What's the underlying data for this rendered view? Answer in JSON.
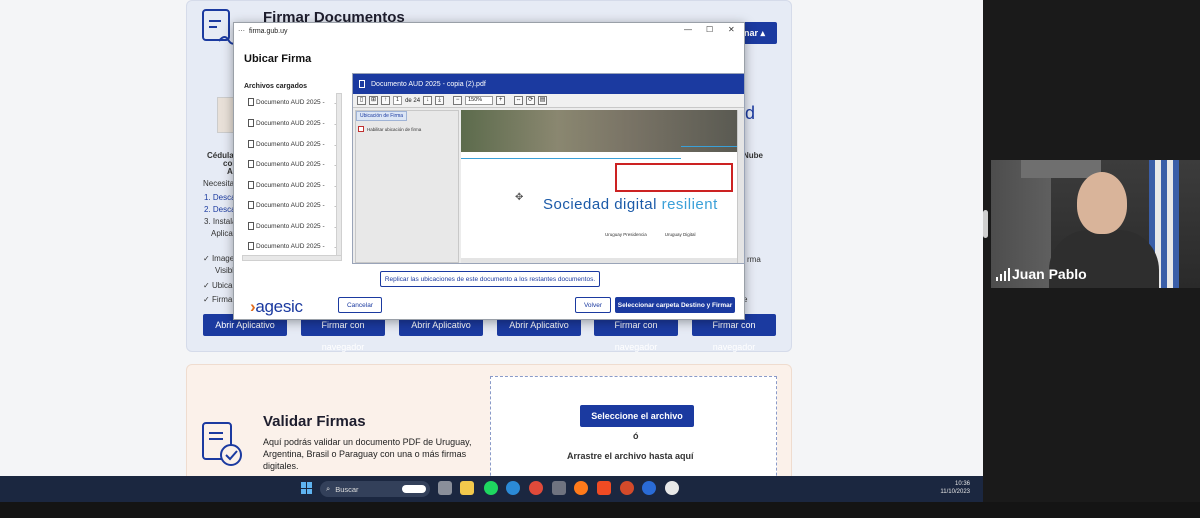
{
  "website": {
    "firmar_heading": "Firmar Documentos",
    "firmar_button": "… nar ▴",
    "cedula_col": [
      "Cédula",
      "con",
      "Ap"
    ],
    "necesitar": "Necesitar",
    "steps": [
      "1. Descar",
      "2. Descar",
      "3. Instalar",
      "Aplicat"
    ],
    "checks": [
      "Image",
      "Visible",
      "Ubica",
      "Firma"
    ],
    "id_fragment": "id",
    "nube_fragment": "Nube",
    "right_frag": "rma",
    "right_frag2": "e",
    "action_buttons": [
      "Abrir Aplicativo",
      "Firmar con navegador",
      "Abrir Aplicativo",
      "Abrir Aplicativo",
      "Firmar con navegador",
      "Firmar con navegador"
    ],
    "validar_heading": "Validar Firmas",
    "validar_text": [
      "Aquí podrás validar un documento PDF de Uruguay,",
      "Argentina, Brasil o Paraguay con una o más firmas",
      "digitales."
    ],
    "select_file_button": "Seleccione el archivo",
    "or_text": "ó",
    "drag_text": "Arrastre el archivo hasta aquí"
  },
  "dialog": {
    "url": "firma.gub.uy",
    "title": "Ubicar Firma",
    "files_label": "Archivos cargados",
    "files": [
      "Documento AUD 2025 -",
      "Documento AUD 2025 -",
      "Documento AUD 2025 -",
      "Documento AUD 2025 -",
      "Documento AUD 2025 -",
      "Documento AUD 2025 -",
      "Documento AUD 2025 -",
      "Documento AUD 2025 -"
    ],
    "viewer_title": "Documento AUD 2025 - copia (2).pdf",
    "page_current": "1",
    "page_total": "de 24",
    "zoom": "150%",
    "side_tab": "Ubicación de Firma",
    "side_check_label": "Habilitar ubicación de firma",
    "page_text_main": "Sociedad digital ",
    "page_text_accent": "resilient",
    "page_logos": [
      "Uruguay Presidencia",
      "Uruguay Digital"
    ],
    "replicate_button": "Replicar las ubicaciones de este documento a los restantes documentos.",
    "cancel_button": "Cancelar",
    "back_button": "Volver",
    "select_dest_button": "Seleccionar carpeta Destino y Firmar",
    "logo_text": "agesic"
  },
  "webcam": {
    "participant_name": "Juan Pablo"
  },
  "taskbar": {
    "search_placeholder": "Buscar",
    "time": "10:36",
    "date": "11/10/2023"
  },
  "colors": {
    "brand_blue": "#1b3aa0",
    "signature_box": "#cc2222",
    "taskbar": "#1b2740"
  }
}
